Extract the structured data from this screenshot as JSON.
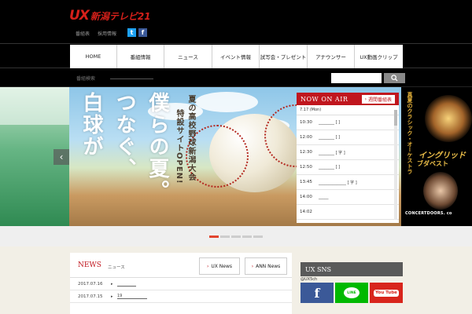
{
  "header": {
    "logo_mark": "UX",
    "logo_name": "新潟テレビ21",
    "links": [
      "番組表",
      "採用情報"
    ],
    "twitter_glyph": "t",
    "facebook_glyph": "f"
  },
  "nav": {
    "items": [
      {
        "label": "HOME"
      },
      {
        "label": "番組情報"
      },
      {
        "label": "ニュース"
      },
      {
        "label": "イベント情報"
      },
      {
        "label": "試写会・プレゼント"
      },
      {
        "label": "アナウンサー"
      },
      {
        "label": "UX動画クリップ"
      }
    ]
  },
  "search": {
    "program_label": "番組検索",
    "button_icon": "search-icon"
  },
  "hero": {
    "slogan": [
      "白球が",
      "つなぐ、",
      "僕らの夏。"
    ],
    "sub_slogan": [
      "夏の高校野球新潟大会",
      "特設サイトOPEN!"
    ],
    "prev_glyph": "‹",
    "next_glyph": "›"
  },
  "now_on_air": {
    "title": "NOW ON AIR",
    "weekly_button": "週間番組表",
    "date": "7.17 (Mon)",
    "slots": [
      {
        "time": "10:30",
        "program": "________ [ ]"
      },
      {
        "time": "12:00",
        "program": "________ [ ]"
      },
      {
        "time": "12:30",
        "program": "________ [ 字 ]"
      },
      {
        "time": "12:50",
        "program": "________ [ ]"
      },
      {
        "time": "13:45",
        "program": "______________ [ 字 ]"
      },
      {
        "time": "14:00",
        "program": "_____"
      },
      {
        "time": "14:02",
        "program": ""
      }
    ]
  },
  "side_ad": {
    "vertical": "真夏のクラシック・オーケストラ",
    "line1": "イングリッド",
    "line2": "ブダペスト",
    "footer": "CONCERTDOORS. co"
  },
  "news": {
    "title": "NEWS",
    "subtitle": "ニュース",
    "tab_ux": "UX News",
    "tab_ann": "ANN News",
    "items": [
      {
        "date": "2017.07.16",
        "text": ""
      },
      {
        "date": "2017.07.15",
        "text": "19"
      }
    ]
  },
  "sns": {
    "title": "UX SNS",
    "handle": "@UX5ch",
    "facebook": "f",
    "line": "LINE",
    "youtube": "You Tube"
  },
  "colors": {
    "brand_red": "#c0161e",
    "facebook": "#3b5998",
    "line": "#00b900",
    "youtube": "#d8251c",
    "pager_active": "#e2452f"
  }
}
